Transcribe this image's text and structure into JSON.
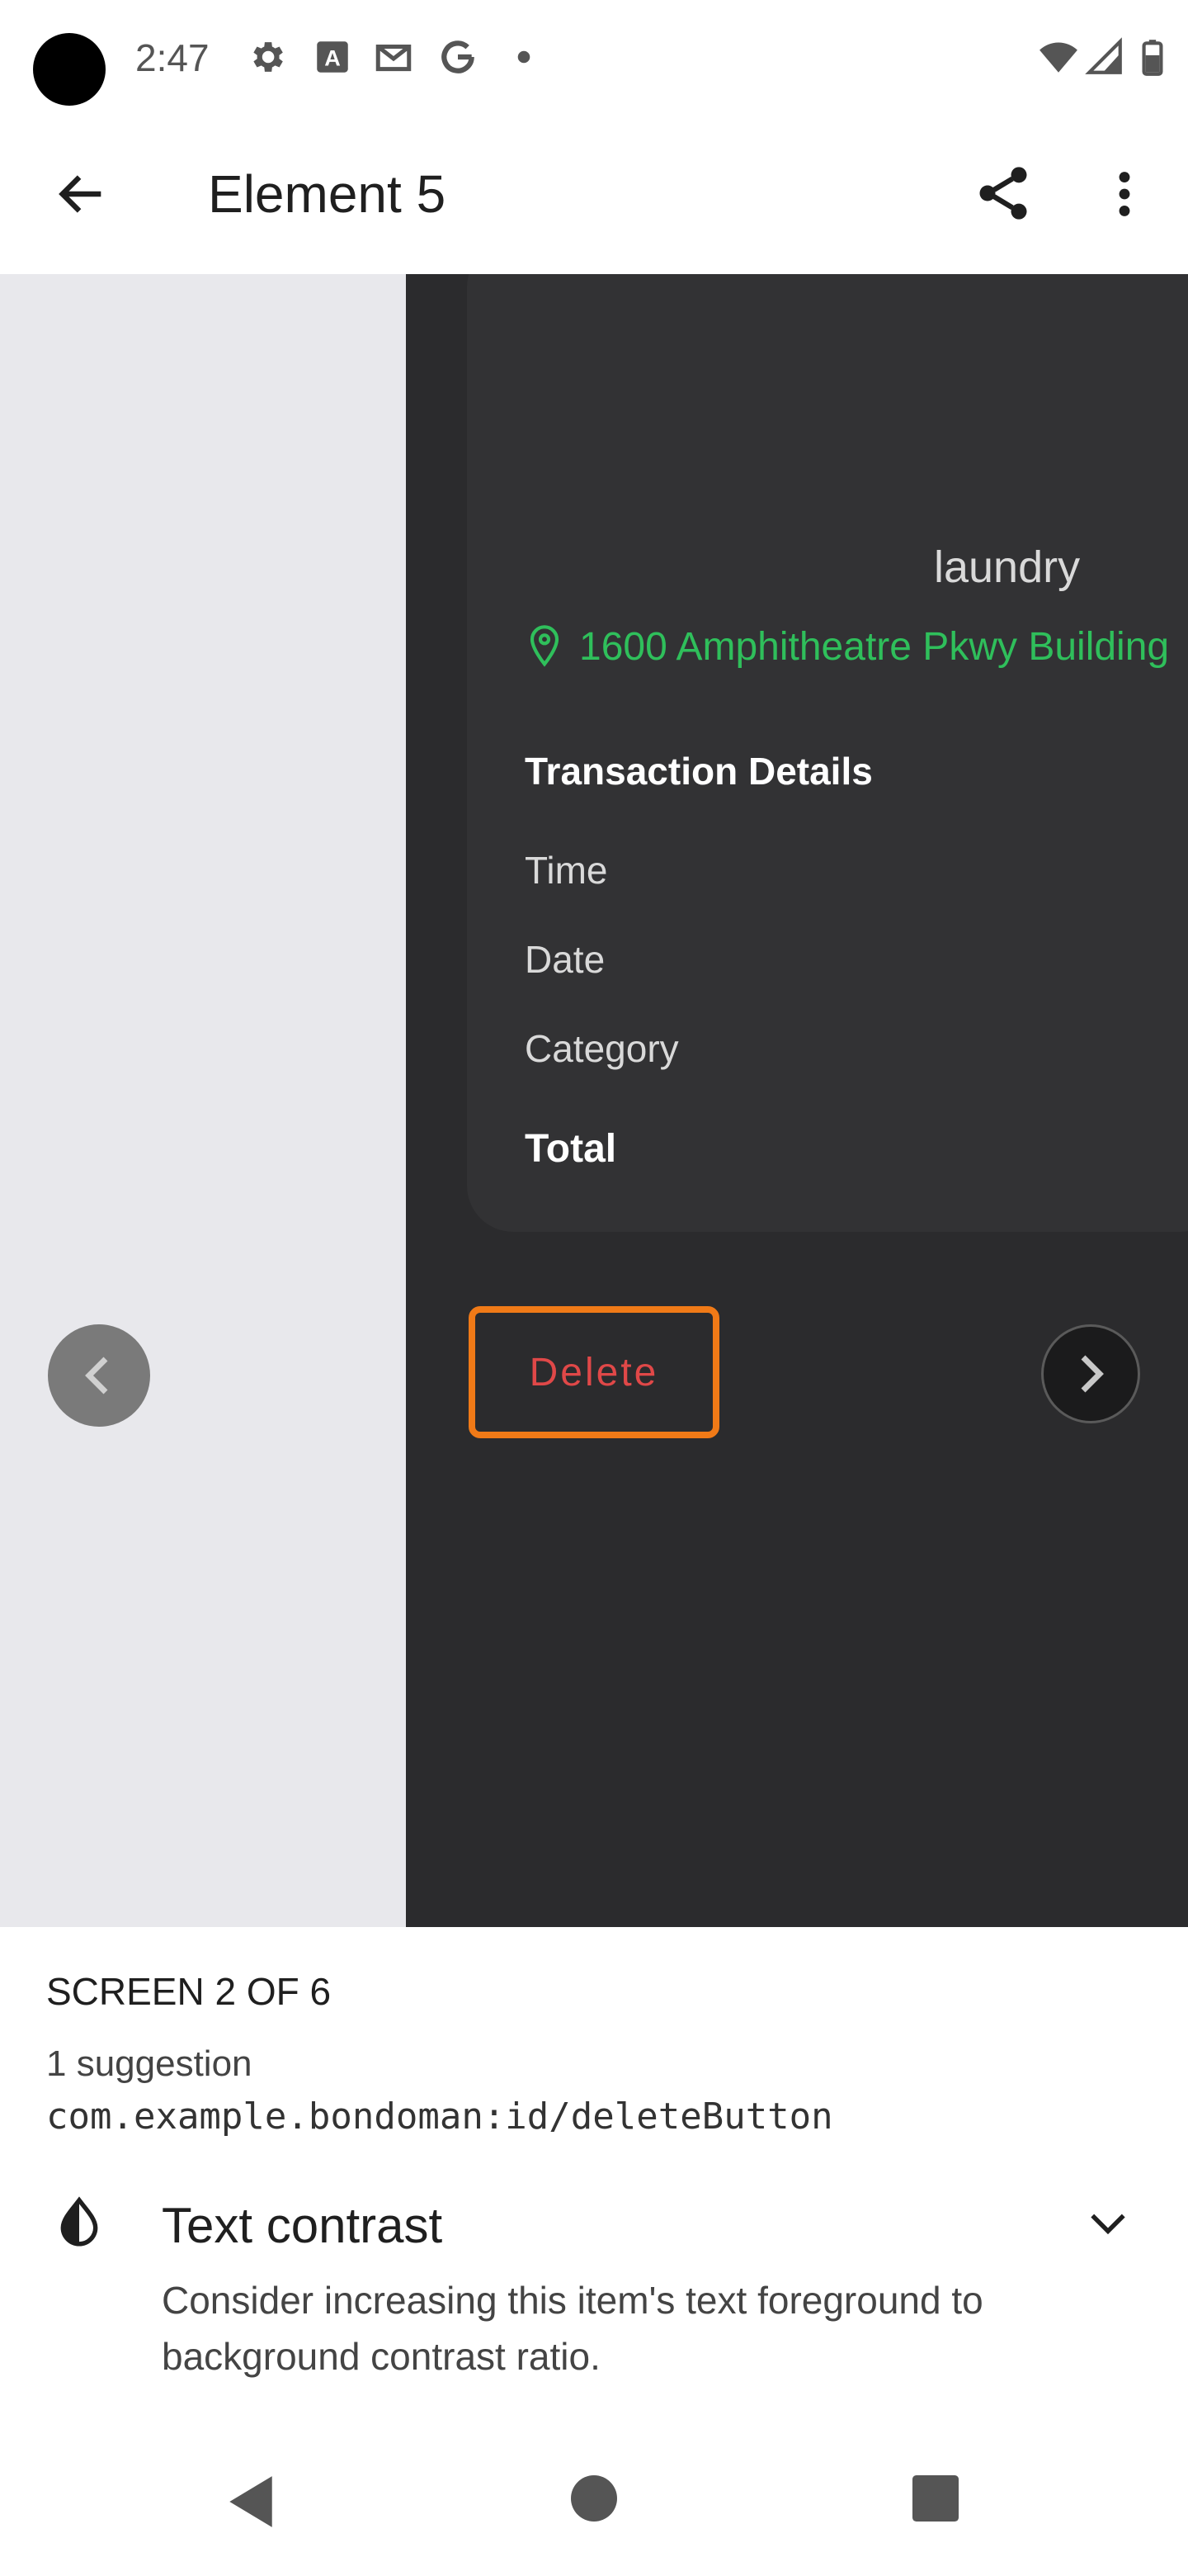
{
  "status_bar": {
    "time": "2:47",
    "icons": [
      "camera-cutout-icon",
      "settings-icon",
      "a-box-icon",
      "gmail-icon",
      "google-icon",
      "dot-icon",
      "wifi-icon",
      "signal-icon",
      "battery-icon"
    ]
  },
  "app_bar": {
    "title": "Element 5",
    "icons": [
      "back-arrow-icon",
      "share-icon",
      "more-vert-icon"
    ]
  },
  "preview": {
    "partial_title": "laundry",
    "address": "1600 Amphitheatre Pkwy Building",
    "transaction_heading": "Transaction Details",
    "rows": {
      "time": "Time",
      "date": "Date",
      "category": "Category",
      "total": "Total"
    },
    "delete_label": "Delete",
    "colors": {
      "dark_panel": "#2b2b2d",
      "card": "#323234",
      "address_green": "#2fbf5b",
      "delete_red": "#e04848",
      "highlight_orange": "#f07a17"
    }
  },
  "sheet": {
    "screen_counter": "SCREEN 2 OF 6",
    "suggestion_count": "1 suggestion",
    "resource_id": "com.example.bondoman:id/deleteButton",
    "suggestion_title": "Text contrast",
    "suggestion_desc": "Consider increasing this item's text foreground to background contrast ratio."
  }
}
